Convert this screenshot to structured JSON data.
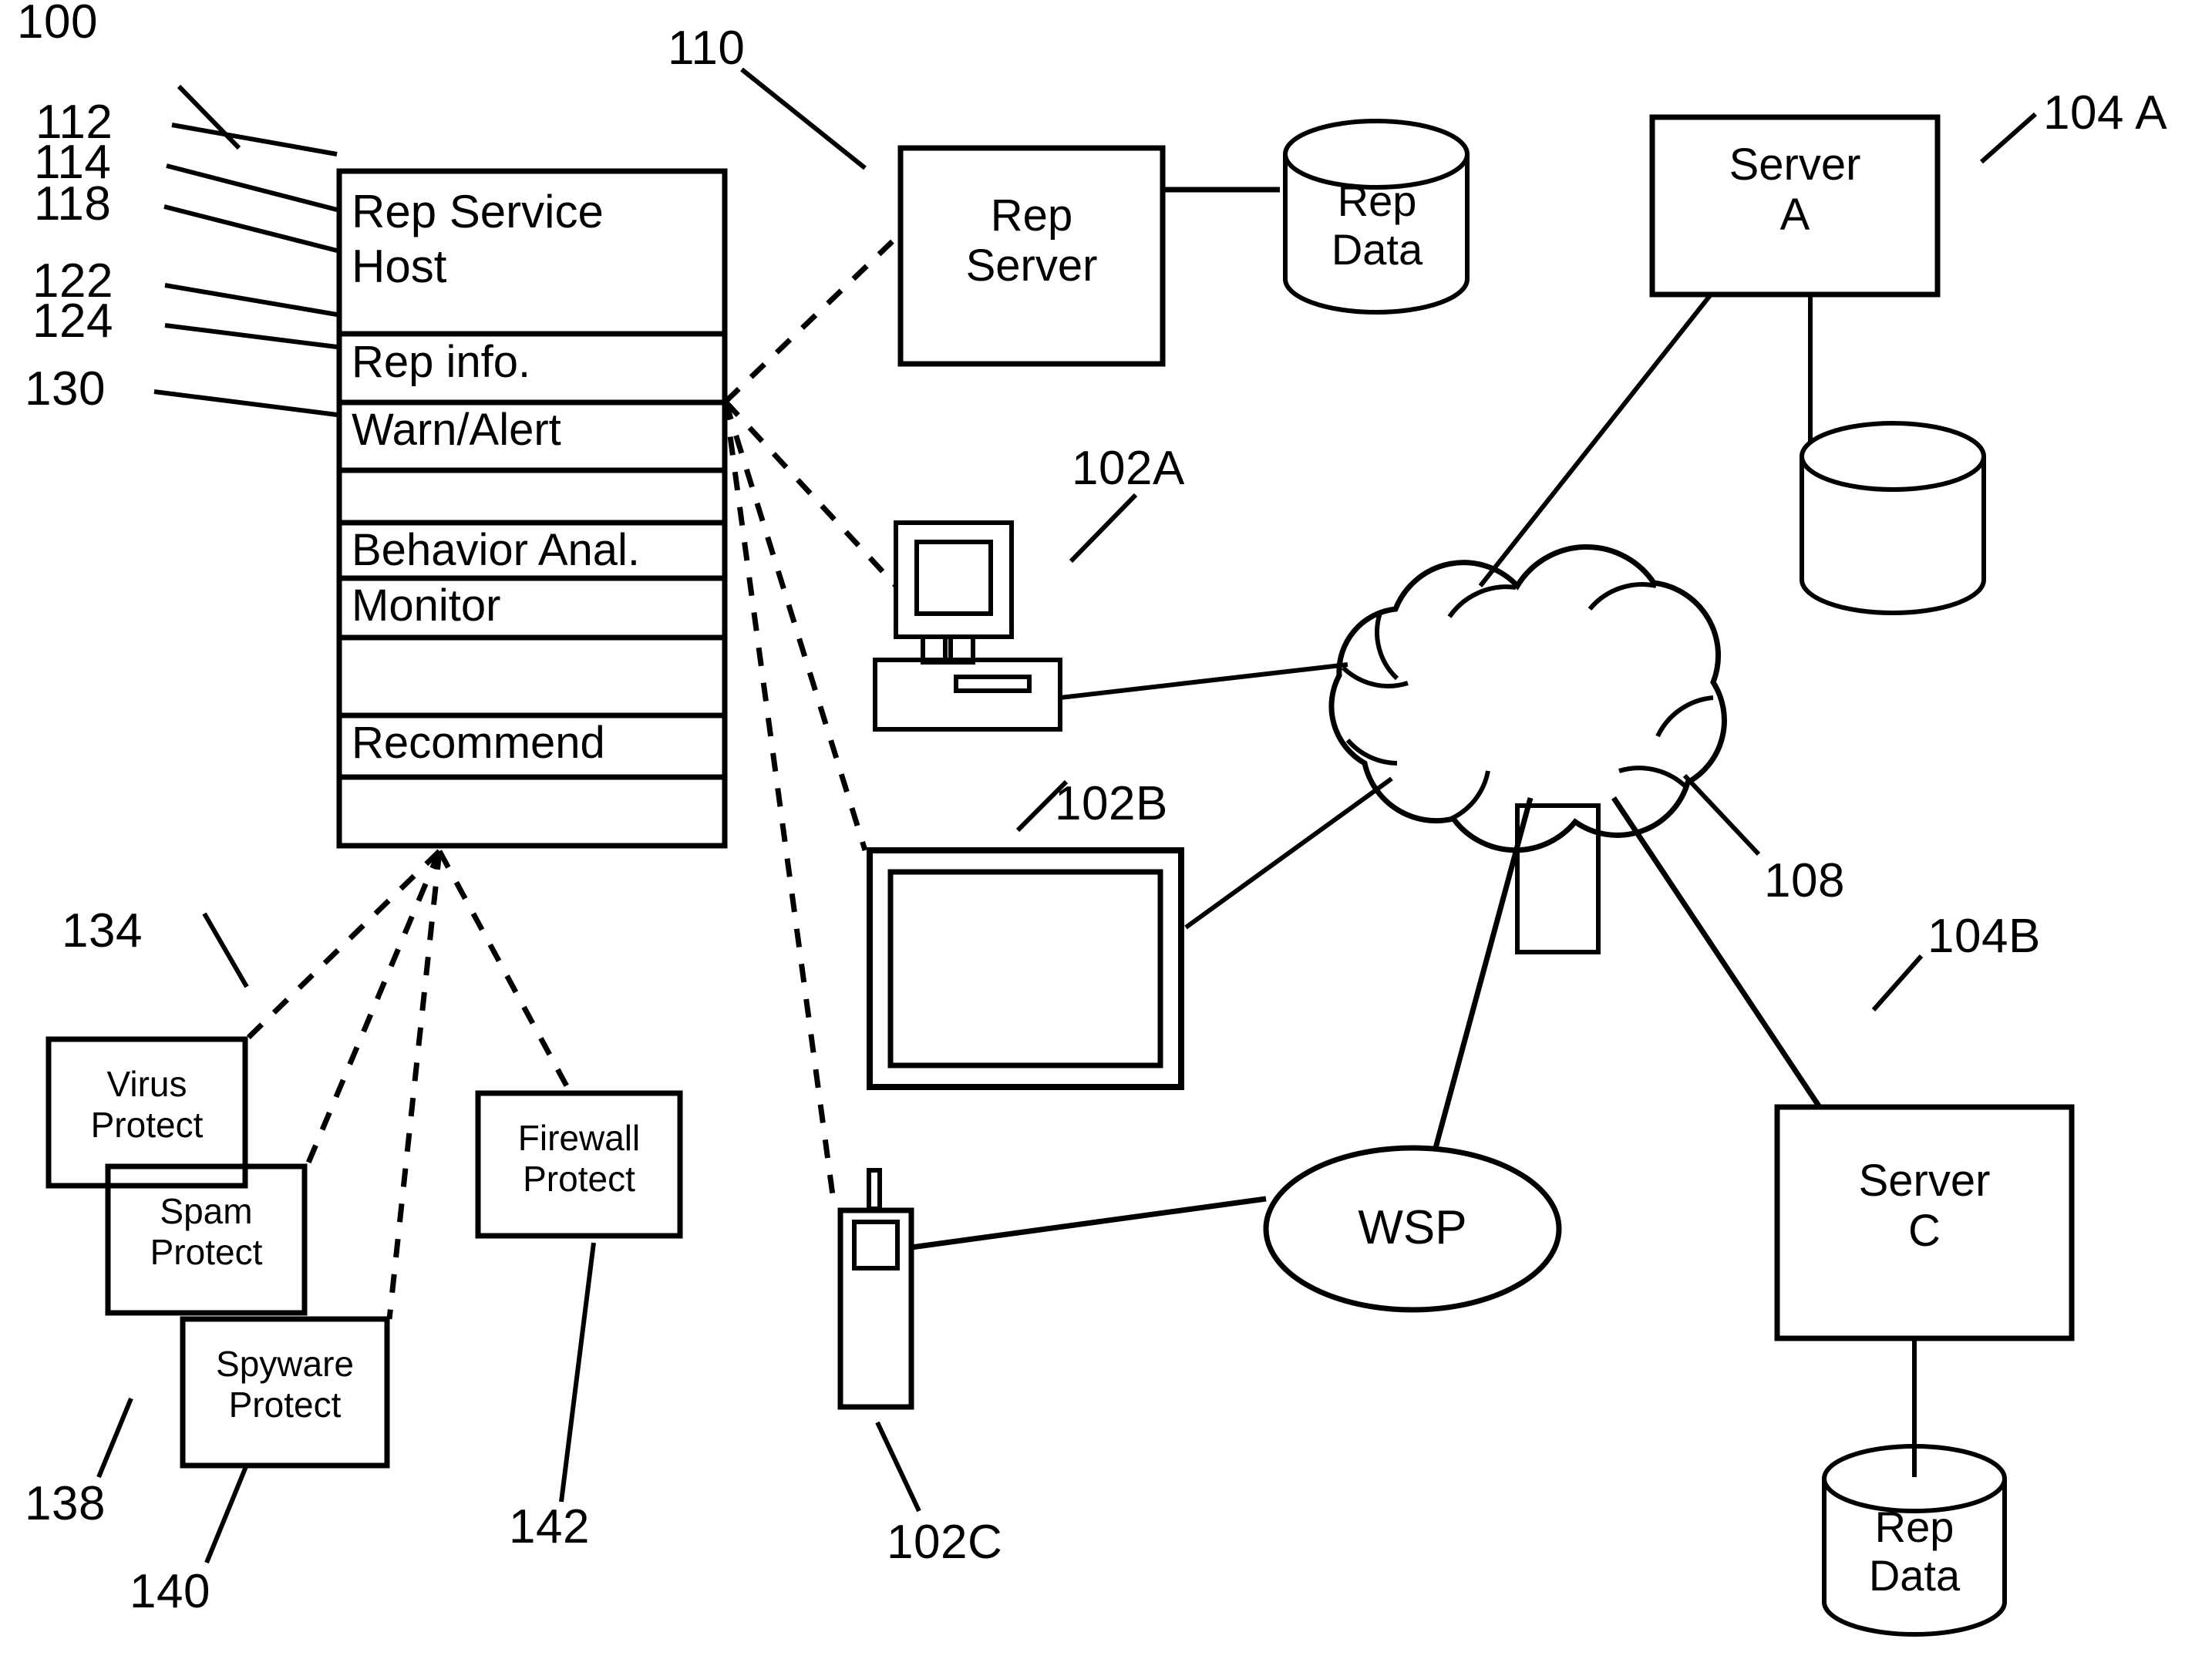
{
  "figure": {
    "title_ref": "100",
    "type": "patent-network-diagram"
  },
  "refs": {
    "system": "100",
    "rep_server": "110",
    "rep_service_host": "112",
    "rep_info": "114",
    "warn_alert": "118",
    "behavior_anal": "122",
    "monitor": "124",
    "recommend": "130",
    "virus_protect": "134",
    "spam_protect": "138",
    "spyware_protect": "140",
    "firewall_protect": "142",
    "client_a": "102A",
    "client_b": "102B",
    "client_c": "102C",
    "server_a": "104 A",
    "server_c": "104B",
    "network": "108"
  },
  "rep_service_host": {
    "title": "Rep Service\nHost",
    "rows": [
      {
        "label": "Rep info."
      },
      {
        "label": "Warn/Alert"
      },
      {
        "label": ""
      },
      {
        "label": "Behavior Anal."
      },
      {
        "label": "Monitor"
      },
      {
        "label": ""
      },
      {
        "label": "Recommend"
      },
      {
        "label": ""
      }
    ]
  },
  "nodes": {
    "rep_server": {
      "label": "Rep\nServer"
    },
    "rep_data_top": {
      "label": "Rep\nData"
    },
    "server_a": {
      "label": "Server\nA"
    },
    "server_a_db": {
      "label": ""
    },
    "server_c": {
      "label": "Server\nC"
    },
    "rep_data_bottom": {
      "label": "Rep\nData"
    },
    "wsp": {
      "label": "WSP"
    },
    "network_cloud": {
      "label": ""
    },
    "client_a_desktop": {
      "label": ""
    },
    "client_b_display": {
      "label": ""
    },
    "client_c_phone": {
      "label": ""
    }
  },
  "protect_modules": [
    {
      "label": "Virus\nProtect",
      "ref": "134"
    },
    {
      "label": "Spam\nProtect",
      "ref": "138"
    },
    {
      "label": "Spyware\nProtect",
      "ref": "140"
    },
    {
      "label": "Firewall\nProtect",
      "ref": "142"
    }
  ],
  "colors": {
    "stroke": "#000000",
    "background": "#ffffff"
  }
}
